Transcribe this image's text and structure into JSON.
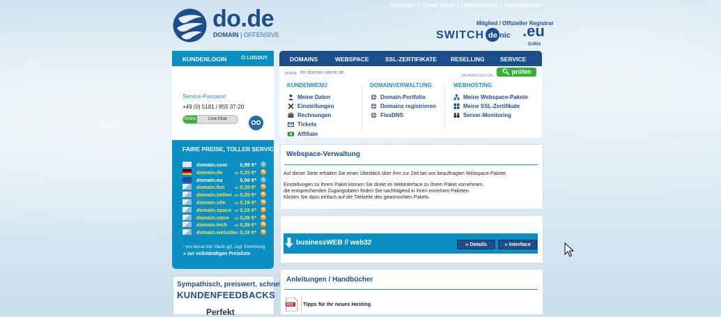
{
  "toplinks": [
    "Startseite",
    "Unser Team",
    "Unternehmen",
    "Umweltschutz"
  ],
  "logo": {
    "name": "do.de",
    "sub_bold": "DOMAIN",
    "sub_light": "OFFENSIVE"
  },
  "registrar": {
    "text": "Mitglied / Offizieller Registrar",
    "switch": "SWITCH",
    "denic": "denic",
    "eu": ".eu",
    "eu_small": "EURid"
  },
  "login": {
    "title": "KUNDENLOGIN",
    "logout": "LOGOUT",
    "service_password": "Service-Passwort",
    "phone": "+49 (0) 5181 / 855 37-20",
    "online": "Online",
    "livechat": "Live Chat"
  },
  "prices": {
    "title": "FAIRE PREISE, TOLLER SERVICE",
    "rows": [
      {
        "domain": "domain.com",
        "price": "0,99 €*",
        "highlight": false,
        "badge": "i"
      },
      {
        "domain": "domain.de",
        "prefix": "ab",
        "price": "0,25 €*",
        "highlight": true,
        "badge": "%"
      },
      {
        "domain": "domain.eu",
        "price": "0,59 €*",
        "highlight": false,
        "badge": "i"
      },
      {
        "domain": "domain.fun",
        "prefix": "ab",
        "price": "0,19 €*",
        "highlight": true,
        "badge": "%"
      },
      {
        "domain": "domain.online",
        "prefix": "ab",
        "price": "0,29 €*",
        "highlight": true,
        "badge": "%"
      },
      {
        "domain": "domain.site",
        "prefix": "ab",
        "price": "0,19 €*",
        "highlight": true,
        "badge": "%"
      },
      {
        "domain": "domain.space",
        "prefix": "ab",
        "price": "0,19 €*",
        "highlight": true,
        "badge": "%"
      },
      {
        "domain": "domain.store",
        "prefix": "ab",
        "price": "0,29 €*",
        "highlight": true,
        "badge": "%"
      },
      {
        "domain": "domain.tech",
        "prefix": "ab",
        "price": "0,39 €*",
        "highlight": true,
        "badge": "%"
      },
      {
        "domain": "domain.website",
        "prefix": "ab",
        "price": "0,19 €*",
        "highlight": true,
        "badge": "%"
      }
    ],
    "note": "* pro Monat inkl. MwSt ggf. zzgl. Einrichtung",
    "more": "» zur vollständigen Preisliste"
  },
  "feedback": {
    "line1": "Sympathisch, preiswert, schnell...",
    "line2": "KUNDENFEEDBACKS",
    "line3": "Perfekt"
  },
  "nav": [
    "DOMAINS",
    "WEBSPACE",
    "SSL-ZERTIFIKATE",
    "RESELLING",
    "SERVICE"
  ],
  "search": {
    "www": "www.",
    "placeholder": "ihr-domain-name.de",
    "multi": "↓ MEHRFACHSUCHE",
    "button": "prüfen"
  },
  "menu": {
    "kundenmenue": {
      "title": "KUNDENMENÜ",
      "items": [
        "Meine Daten",
        "Einstellungen",
        "Rechnungen",
        "Tickets",
        "Affiliate"
      ]
    },
    "domainverwaltung": {
      "title": "DOMAINVERWALTUNG",
      "items": [
        "Domain-Portfolio",
        "Domains registrieren",
        "FlexDNS"
      ]
    },
    "webhosting": {
      "title": "WEBHOSTING",
      "items": [
        "Meine Webspace-Pakete",
        "Meine SSL-Zertifikate",
        "Server-Monitoring"
      ]
    }
  },
  "webspace": {
    "title": "Webspace-Verwaltung",
    "p1": "Auf dieser Seite erhalten Sie einen Überblick über Ihre zur Zeit bei uns beauftragten Webspace-Pakete.",
    "p2a": "Einstellungen zu Ihrem Paket können Sie direkt im Webinterface zu Ihrem Paket vornehmen,",
    "p2b": "die entsprechenden Zugangsdaten finden Sie nachfolgend in ihren einzelnen Paketen.",
    "p2c": "Klicken Sie dazu einfach auf die Titelzeile des gewünschten Pakets."
  },
  "package": {
    "name": "businessWEB // web32",
    "details": "» Details",
    "interface": "» Interface"
  },
  "guides": {
    "title": "Anleitungen / Handbücher",
    "item": "Tipps für Ihr neues Hosting"
  },
  "colors": {
    "navy": "#1d4e8c",
    "cyan": "#0b8fc2",
    "green": "#3cae3a",
    "yellow": "#ffe04a",
    "orange": "#f39a1e"
  }
}
